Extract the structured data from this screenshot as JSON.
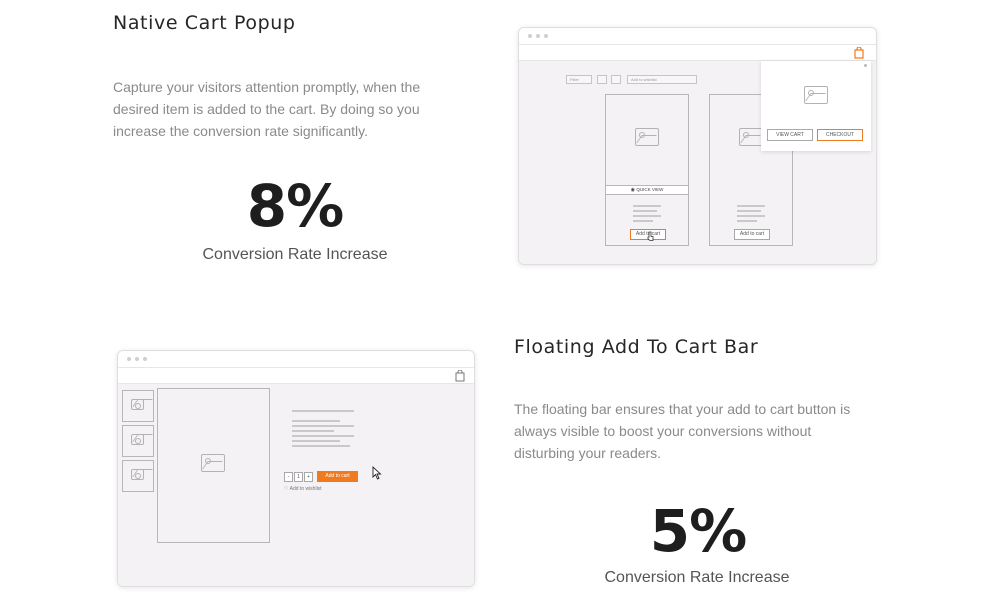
{
  "popup_section": {
    "title": "Native Cart Popup",
    "description_lines": [
      "Capture your visitors attention promptly, when the",
      "desired item is added to the cart. By doing so you",
      "increase the conversion rate significantly."
    ],
    "stat_value": "8%",
    "stat_label": "Conversion Rate Increase",
    "mock": {
      "toolbar_items": [
        "Filter",
        "",
        "",
        "Add to wishlist"
      ],
      "product_left": {
        "quick_view_label": "QUICK VIEW",
        "add_to_cart_label": "Add to cart"
      },
      "product_right": {
        "add_to_cart_label": "Add to cart"
      },
      "popup": {
        "view_cart_label": "VIEW CART",
        "checkout_label": "CHECKOUT"
      },
      "cart_icon": "shopping-bag-icon"
    }
  },
  "bar_section": {
    "title": "Floating Add To Cart Bar",
    "description_lines": [
      "The floating bar ensures that your add to cart button is",
      "always visible to boost your conversions without",
      "disturbing your readers."
    ],
    "stat_value": "5%",
    "stat_label": "Conversion Rate Increase",
    "mock": {
      "qty_minus": "-",
      "qty_value": "1",
      "qty_plus": "+",
      "add_to_cart_label": "Add to cart",
      "wishlist_label": "Add to wishlist",
      "cart_icon": "shopping-bag-icon"
    }
  },
  "colors": {
    "accent": "#f07a1f",
    "heading": "#262626",
    "text_muted": "#8a8a8a"
  }
}
